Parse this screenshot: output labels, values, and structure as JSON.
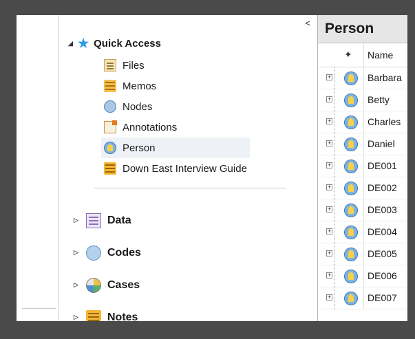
{
  "nav": {
    "collapse_glyph": "<",
    "quick_access": {
      "label": "Quick Access",
      "icon": "star-icon",
      "items": [
        {
          "label": "Files",
          "icon": "files-icon"
        },
        {
          "label": "Memos",
          "icon": "memos-icon"
        },
        {
          "label": "Nodes",
          "icon": "nodes-icon"
        },
        {
          "label": "Annotations",
          "icon": "annotations-icon"
        },
        {
          "label": "Person",
          "icon": "person-icon",
          "selected": true
        },
        {
          "label": "Down East Interview Guide",
          "icon": "document-icon"
        }
      ]
    },
    "sections": [
      {
        "label": "Data",
        "icon": "data-icon"
      },
      {
        "label": "Codes",
        "icon": "codes-icon"
      },
      {
        "label": "Cases",
        "icon": "cases-icon"
      },
      {
        "label": "Notes",
        "icon": "notes-icon"
      }
    ]
  },
  "pane": {
    "title": "Person",
    "column_header": "Name",
    "rows": [
      "Barbara",
      "Betty",
      "Charles",
      "Daniel",
      "DE001",
      "DE002",
      "DE003",
      "DE004",
      "DE005",
      "DE006",
      "DE007"
    ]
  },
  "colors": {
    "accent_star": "#2a9ae6",
    "selected_bg": "#eef1f6",
    "pane_header_bg": "#e6e6e6",
    "outer_bg": "#4a4a4a"
  }
}
